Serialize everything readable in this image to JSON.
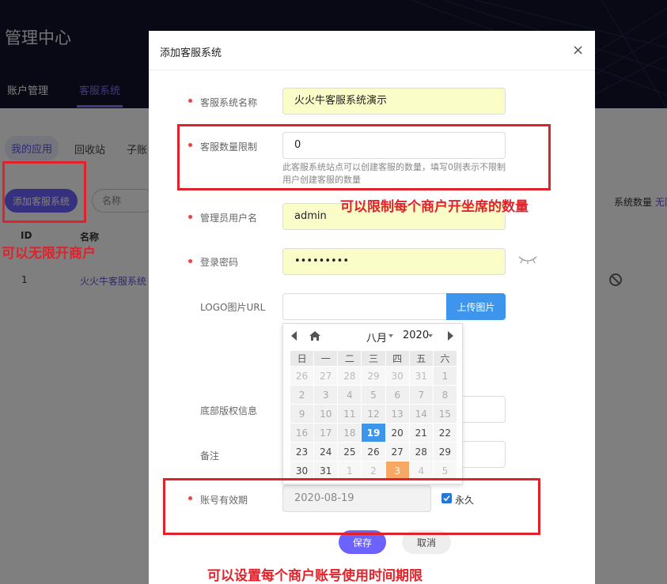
{
  "app": {
    "title": "管理中心",
    "nav": [
      "账户管理",
      "客服系统"
    ],
    "subtabs": [
      "我的应用",
      "回收站",
      "子账"
    ],
    "add_button": "添加客服系统",
    "search_placeholder": "名称",
    "quota_label": "系统数量",
    "quota_value": "无限制",
    "table": {
      "columns": [
        "ID",
        "名称"
      ],
      "rows": [
        {
          "id": "1",
          "name": "火火牛客服系统"
        }
      ]
    }
  },
  "modal": {
    "title": "添加客服系统",
    "close_icon": "close-icon",
    "fields": {
      "system_name": {
        "label": "客服系统名称",
        "value": "火火牛客服系统演示"
      },
      "agent_limit": {
        "label": "客服数量限制",
        "value": "0",
        "hint": "此客服系统站点可以创建客服的数量，填写0则表示不限制用户创建客服的数量"
      },
      "admin_user": {
        "label": "管理员用户名",
        "value": "admin"
      },
      "password": {
        "label": "登录密码",
        "value": "•••••••••"
      },
      "logo": {
        "label": "LOGO图片URL",
        "value": "",
        "upload_label": "上传图片"
      },
      "copyright": {
        "label": "底部版权信息",
        "value": ""
      },
      "remark": {
        "label": "备注",
        "value": ""
      },
      "expiry": {
        "label": "账号有效期",
        "value": "2020-08-19",
        "permanent_label": "永久",
        "permanent_checked": true
      }
    },
    "save_button": "保存",
    "cancel_button": "取消"
  },
  "datepicker": {
    "month": "八月",
    "year": "2020",
    "weekdays": [
      "日",
      "一",
      "二",
      "三",
      "四",
      "五",
      "六"
    ],
    "weeks": [
      [
        "26",
        "27",
        "28",
        "29",
        "30",
        "31",
        "1"
      ],
      [
        "2",
        "3",
        "4",
        "5",
        "6",
        "7",
        "8"
      ],
      [
        "9",
        "10",
        "11",
        "12",
        "13",
        "14",
        "15"
      ],
      [
        "16",
        "17",
        "18",
        "19",
        "20",
        "21",
        "22"
      ],
      [
        "23",
        "24",
        "25",
        "26",
        "27",
        "28",
        "29"
      ],
      [
        "30",
        "31",
        "1",
        "2",
        "3",
        "4",
        "5"
      ]
    ],
    "selected": "19",
    "today": "3"
  },
  "annotations": {
    "unlimited_merchants": "可以无限开商户",
    "limit_agents": "可以限制每个商户开坐席的数量",
    "expiry_limit": "可以设置每个商户账号使用时间期限"
  },
  "colors": {
    "accent": "#6c63ff",
    "annotation": "#e2222a",
    "header_bg": "#12122a",
    "upload_blue": "#3d96ec"
  }
}
